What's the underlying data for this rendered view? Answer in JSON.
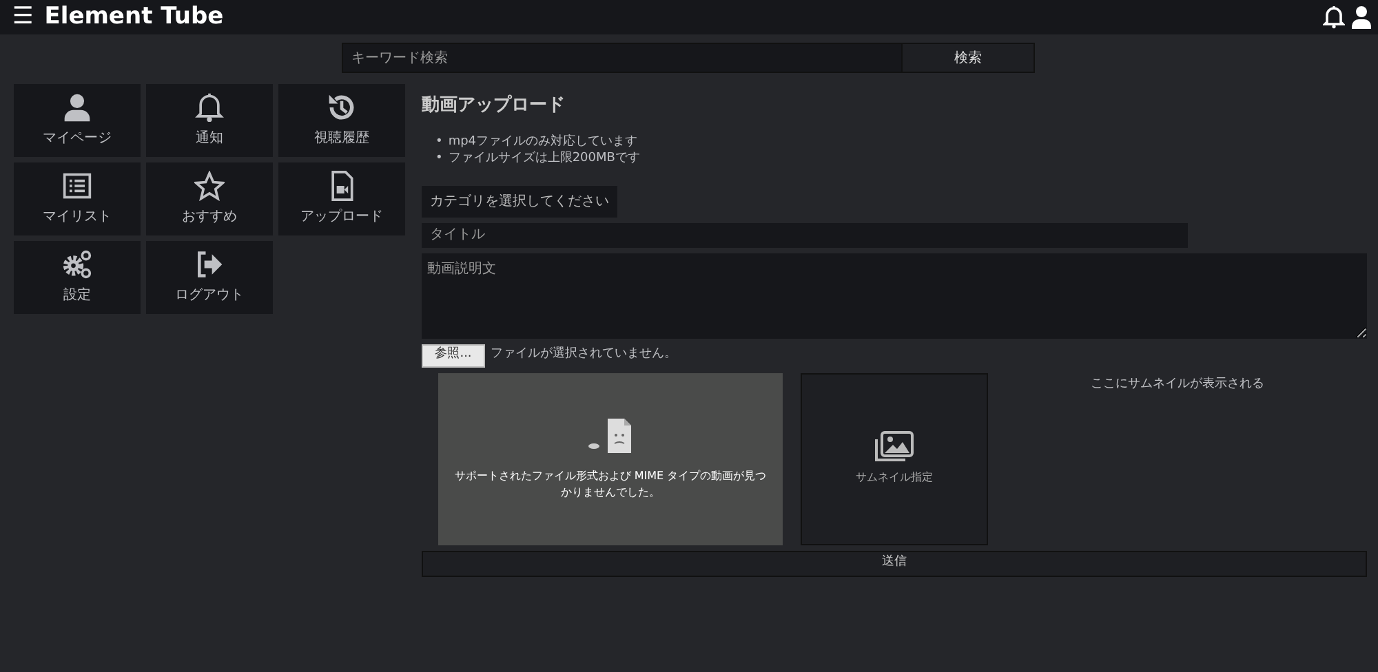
{
  "header": {
    "menu_glyph": "☰",
    "brand": "Element Tube"
  },
  "search": {
    "placeholder": "キーワード検索",
    "button": "検索"
  },
  "menu": [
    {
      "label": "マイページ",
      "kind": "user"
    },
    {
      "label": "通知",
      "kind": "bell"
    },
    {
      "label": "視聴履歴",
      "kind": "history"
    },
    {
      "label": "マイリスト",
      "kind": "list"
    },
    {
      "label": "おすすめ",
      "kind": "star"
    },
    {
      "label": "アップロード",
      "kind": "file"
    },
    {
      "label": "設定",
      "kind": "gears"
    },
    {
      "label": "ログアウト",
      "kind": "logout"
    }
  ],
  "upload": {
    "title": "動画アップロード",
    "bullet": "•",
    "notes": [
      "mp4ファイルのみ対応しています",
      "ファイルサイズは上限200MBです"
    ],
    "category_button": "カテゴリを選択してください",
    "title_placeholder": "タイトル",
    "description_placeholder": "動画説明文",
    "file_button": "参照...",
    "file_status": "ファイルが選択されていません。",
    "video_error": "サポートされたファイル形式および MIME タイプの動画が見つかりませんでした。",
    "thumbnail_button": "サムネイル指定",
    "thumbnail_hint": "ここにサムネイルが表示される",
    "submit": "送信"
  }
}
